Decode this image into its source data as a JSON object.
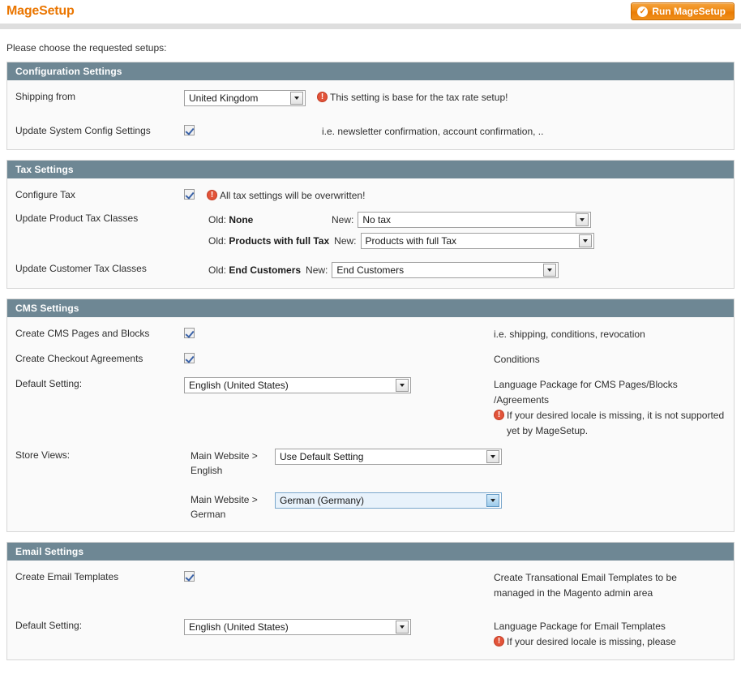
{
  "header": {
    "app_title": "MageSetup",
    "run_button_label": "Run MageSetup",
    "run_button_icon": "check-circle-icon",
    "accent_color": "#ea7601",
    "section_header_color": "#6e8794",
    "warning_color": "#e2543a"
  },
  "intro_text": "Please choose the requested setups:",
  "sections": {
    "configuration": {
      "title": "Configuration Settings",
      "shipping_from": {
        "label": "Shipping from",
        "value": "United Kingdom",
        "hint": "This setting is base for the tax rate setup!"
      },
      "update_system_config": {
        "label": "Update System Config Settings",
        "checked": "true",
        "hint": "i.e. newsletter confirmation, account confirmation, .."
      }
    },
    "tax": {
      "title": "Tax Settings",
      "configure_tax": {
        "label": "Configure Tax",
        "checked": "true",
        "hint": "All tax settings will be overwritten!"
      },
      "product_tax_classes": {
        "label": "Update Product Tax Classes",
        "old_label": "Old:",
        "new_label": "New:",
        "pairs": [
          {
            "old": "None",
            "new": "No tax"
          },
          {
            "old": "Products with full Tax",
            "new": "Products with full Tax"
          }
        ]
      },
      "customer_tax_classes": {
        "label": "Update Customer Tax Classes",
        "old_label": "Old:",
        "new_label": "New:",
        "old": "End Customers",
        "new": "End Customers"
      }
    },
    "cms": {
      "title": "CMS Settings",
      "create_pages": {
        "label": "Create CMS Pages and Blocks",
        "checked": "true",
        "hint": "i.e. shipping, conditions, revocation"
      },
      "create_agreements": {
        "label": "Create Checkout Agreements",
        "checked": "true",
        "hint": "Conditions"
      },
      "default_setting": {
        "label": "Default Setting:",
        "value": "English (United States)",
        "hint_line_1": "Language Package for CMS Pages/Blocks",
        "hint_line_2": "/Agreements",
        "warning": "If your desired locale is missing, it is not supported yet by MageSetup."
      },
      "store_views": {
        "label": "Store Views:",
        "rows": [
          {
            "name_line_1": "Main Website >",
            "name_line_2": "English",
            "value": "Use Default Setting",
            "focused": "false"
          },
          {
            "name_line_1": "Main Website >",
            "name_line_2": "German",
            "value": "German (Germany)",
            "focused": "true"
          }
        ]
      }
    },
    "email": {
      "title": "Email Settings",
      "create_templates": {
        "label": "Create Email Templates",
        "checked": "true",
        "hint_line_1": "Create Transational Email Templates to be",
        "hint_line_2": "managed in the Magento admin area"
      },
      "default_setting": {
        "label": "Default Setting:",
        "value": "English (United States)",
        "hint_line_1": "Language Package for Email Templates",
        "warning": "If your desired locale is missing, please"
      }
    }
  }
}
